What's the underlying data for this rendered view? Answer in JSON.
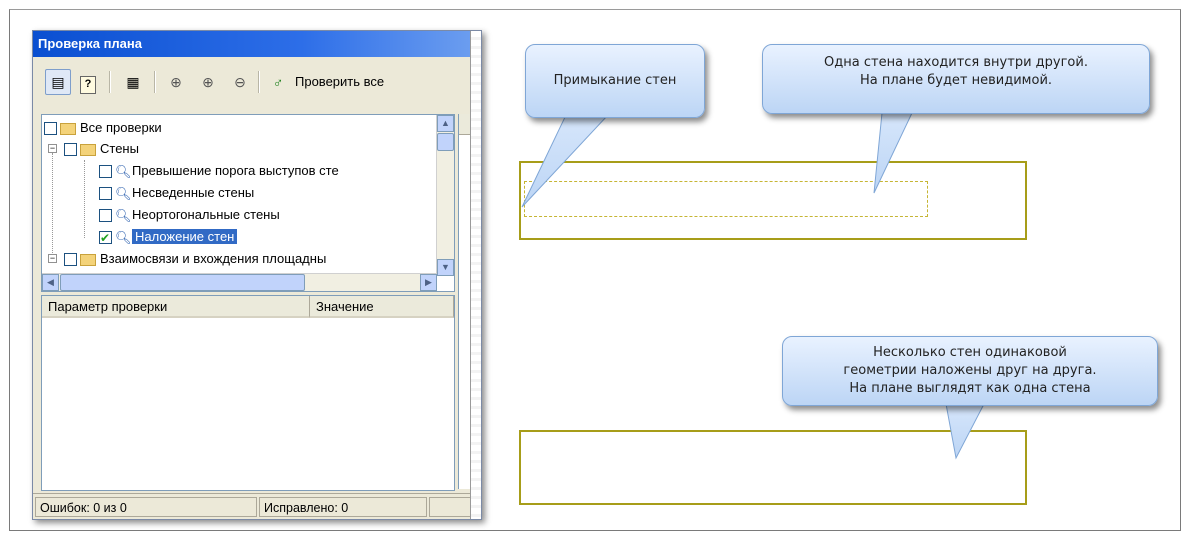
{
  "window": {
    "title": "Проверка плана",
    "toolbar": {
      "check_all_label": "Проверить все",
      "icons": [
        "table-view-icon",
        "help-icon",
        "report-icon",
        "zoom-extents-icon",
        "zoom-in-icon",
        "zoom-out-icon",
        "check-run-icon"
      ]
    },
    "tree": {
      "items": [
        {
          "label": "Все проверки",
          "checked": false
        },
        {
          "label": "Стены",
          "checked": false
        },
        {
          "label": "Превышение порога выступов сте",
          "checked": false
        },
        {
          "label": "Несведенные стены",
          "checked": false
        },
        {
          "label": "Неортогональные стены",
          "checked": false
        },
        {
          "label": "Наложение стен",
          "checked": true,
          "selected": true
        },
        {
          "label": "Взаимосвязи и вхождения площадны",
          "checked": false
        }
      ]
    },
    "params": {
      "col1": "Параметр проверки",
      "col2": "Значение"
    },
    "status": {
      "errors": "Ошибок: 0 из 0",
      "fixed": "Исправлено: 0"
    }
  },
  "callouts": {
    "adjacency": "Примыкание стен",
    "inside": [
      "Одна стена находится внутри другой.",
      "На плане будет невидимой."
    ],
    "overlap": [
      "Несколько стен одинаковой",
      "геометрии наложены друг на друга.",
      "На плане выглядят как одна стена"
    ]
  },
  "colors": {
    "wall": "#a79d19",
    "callout": "#bcd5f5",
    "title_bar": "#0a4fd1",
    "selection": "#316ac5"
  }
}
